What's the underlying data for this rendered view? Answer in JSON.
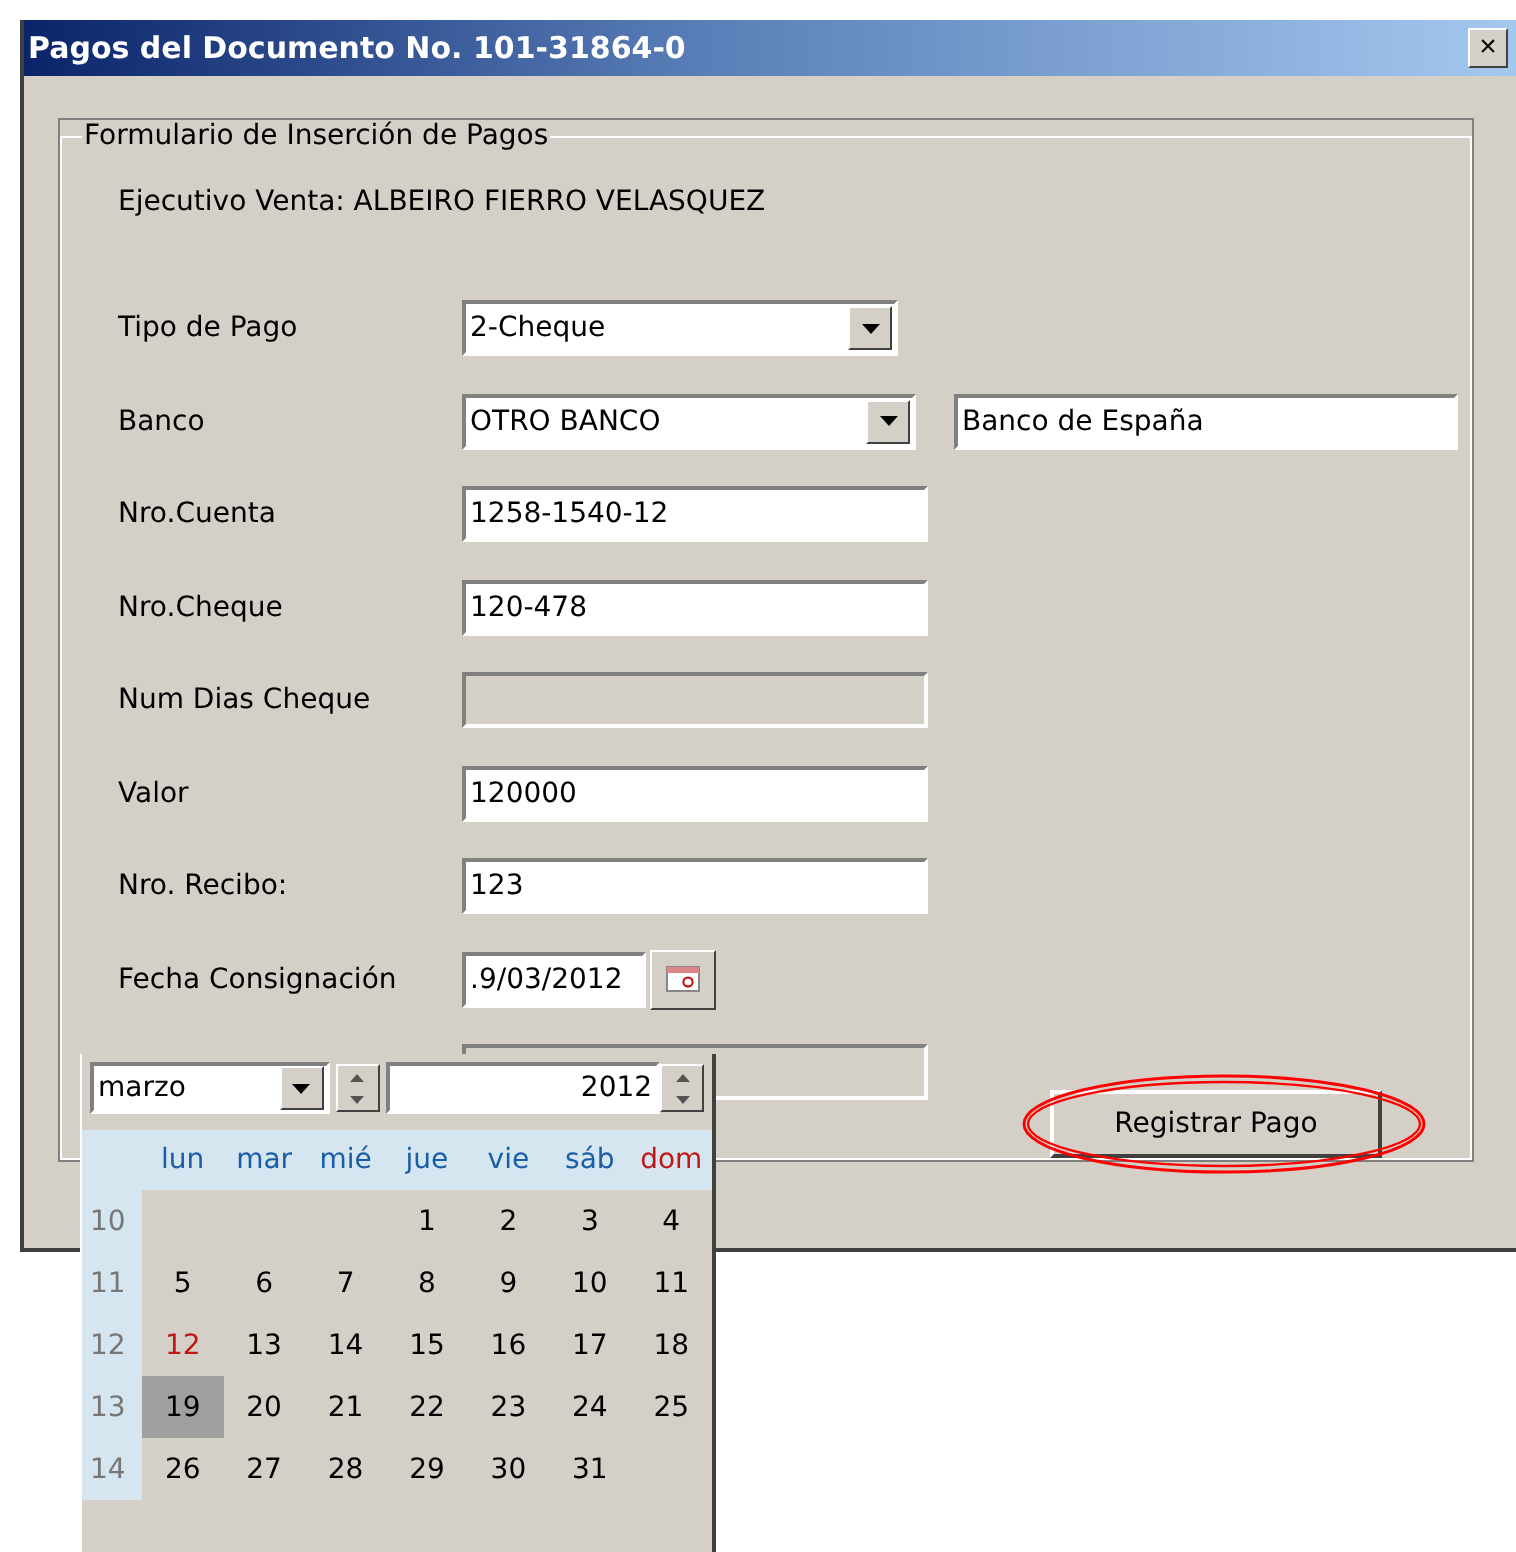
{
  "window": {
    "title": "Pagos del Documento No. 101-31864-0",
    "close": "×"
  },
  "group": {
    "legend": "Formulario de Inserción de Pagos"
  },
  "executive": "Ejecutivo Venta: ALBEIRO FIERRO VELASQUEZ",
  "fields": [
    {
      "kind": "dropdown",
      "label": "Tipo de Pago",
      "value": "2-Cheque",
      "disabled": false
    },
    {
      "kind": "dropdown",
      "label": "Banco",
      "value": "OTRO BANCO",
      "disabled": false,
      "extra": "Banco de España"
    },
    {
      "kind": "text",
      "label": "Nro.Cuenta",
      "value": "1258-1540-12",
      "disabled": false
    },
    {
      "kind": "text",
      "label": "Nro.Cheque",
      "value": "120-478",
      "disabled": false
    },
    {
      "kind": "text",
      "label": "Num Dias Cheque",
      "disabled": true
    },
    {
      "kind": "text",
      "label": "Valor",
      "value": "120000",
      "disabled": false
    },
    {
      "kind": "text",
      "label": "Nro. Recibo:",
      "value": "123",
      "disabled": false
    },
    {
      "kind": "date",
      "label": "Fecha Consignación",
      "value": ".9/03/2012",
      "disabled": false
    },
    {
      "kind": "text",
      "disabled": true
    }
  ],
  "submit": {
    "label": "Registrar Pago",
    "highlighted": true
  },
  "calendar": {
    "month": "marzo",
    "year": "2012",
    "weekdays": [
      {
        "label": "lun",
        "color": "#1a5ea8"
      },
      {
        "label": "mar",
        "color": "#1a5ea8"
      },
      {
        "label": "mié",
        "color": "#1a5ea8"
      },
      {
        "label": "jue",
        "color": "#1a5ea8"
      },
      {
        "label": "vie",
        "color": "#1a5ea8"
      },
      {
        "label": "sáb",
        "color": "#1a5ea8"
      },
      {
        "label": "dom",
        "color": "#c01818"
      }
    ],
    "weeks": [
      {
        "number": "10",
        "days": [
          {
            "label": "1",
            "selected": false,
            "today": false
          },
          {
            "label": "2",
            "selected": false,
            "today": false
          },
          {
            "label": "3",
            "selected": false,
            "today": false
          },
          {
            "label": "4",
            "selected": false,
            "today": false
          }
        ]
      },
      {
        "number": "11",
        "days": [
          {
            "label": "5",
            "selected": false,
            "today": false
          },
          {
            "label": "6",
            "selected": false,
            "today": false
          },
          {
            "label": "7",
            "selected": false,
            "today": false
          },
          {
            "label": "8",
            "selected": false,
            "today": false
          },
          {
            "label": "9",
            "selected": false,
            "today": false
          },
          {
            "label": "10",
            "selected": false,
            "today": false
          },
          {
            "label": "11",
            "selected": false,
            "today": false
          }
        ]
      },
      {
        "number": "12",
        "days": [
          {
            "label": "12",
            "selected": false,
            "today": true
          },
          {
            "label": "13",
            "selected": false,
            "today": false
          },
          {
            "label": "14",
            "selected": false,
            "today": false
          },
          {
            "label": "15",
            "selected": false,
            "today": false
          },
          {
            "label": "16",
            "selected": false,
            "today": false
          },
          {
            "label": "17",
            "selected": false,
            "today": false
          },
          {
            "label": "18",
            "selected": false,
            "today": false
          }
        ]
      },
      {
        "number": "13",
        "days": [
          {
            "label": "19",
            "selected": true,
            "today": false
          },
          {
            "label": "20",
            "selected": false,
            "today": false
          },
          {
            "label": "21",
            "selected": false,
            "today": false
          },
          {
            "label": "22",
            "selected": false,
            "today": false
          },
          {
            "label": "23",
            "selected": false,
            "today": false
          },
          {
            "label": "24",
            "selected": false,
            "today": false
          },
          {
            "label": "25",
            "selected": false,
            "today": false
          }
        ]
      },
      {
        "number": "14",
        "days": [
          {
            "label": "26",
            "selected": false,
            "today": false
          },
          {
            "label": "27",
            "selected": false,
            "today": false
          },
          {
            "label": "28",
            "selected": false,
            "today": false
          },
          {
            "label": "29",
            "selected": false,
            "today": false
          },
          {
            "label": "30",
            "selected": false,
            "today": false
          },
          {
            "label": "31",
            "selected": false,
            "today": false
          }
        ]
      }
    ]
  }
}
